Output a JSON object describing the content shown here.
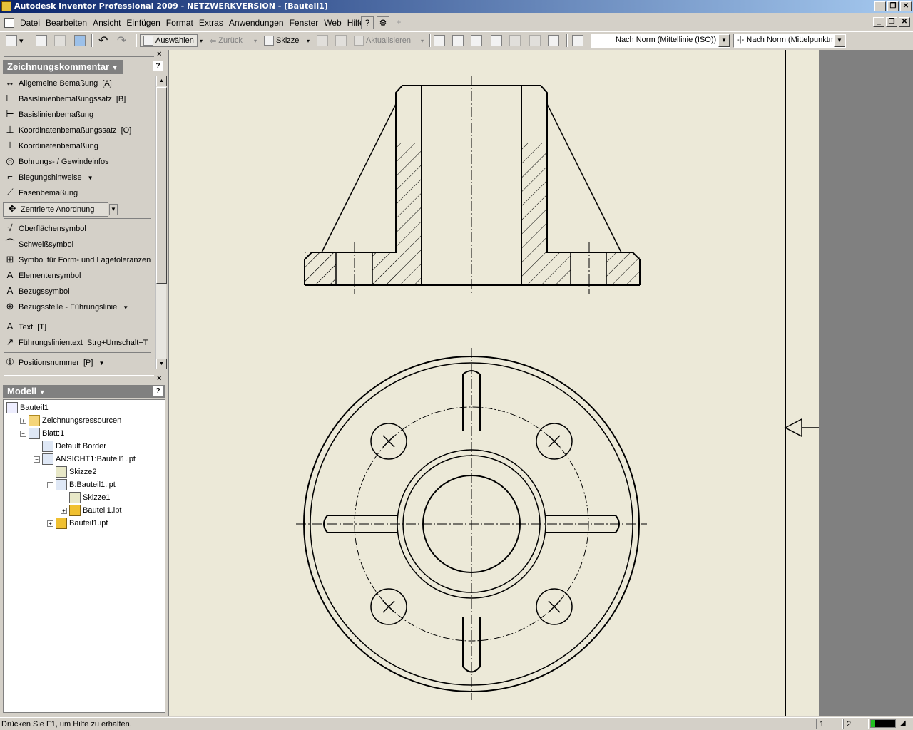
{
  "window": {
    "title": "Autodesk Inventor Professional 2009 - NETZWERKVERSION - [Bauteil1]",
    "min_label": "_",
    "max_label": "❐",
    "close_label": "✕"
  },
  "menu": {
    "items": [
      "Datei",
      "Bearbeiten",
      "Ansicht",
      "Einfügen",
      "Format",
      "Extras",
      "Anwendungen",
      "Fenster",
      "Web",
      "Hilfe"
    ]
  },
  "toolbar": {
    "select_label": "Auswählen",
    "back_label": "Zurück",
    "sketch_label": "Skizze",
    "update_label": "Aktualisieren",
    "layer_combo": "Nach Norm (Mittellinie (ISO))",
    "style_combo": "Nach Norm (Mittelpunktm"
  },
  "annotation_panel": {
    "title": "Zeichnungskommentar",
    "tools": [
      {
        "label": "Allgemeine Bemaßung",
        "shortcut": "[A]",
        "icon": "general-dimension-icon"
      },
      {
        "label": "Basislinienbemaßungssatz",
        "shortcut": "[B]",
        "icon": "baseline-set-icon"
      },
      {
        "label": "Basislinienbemaßung",
        "shortcut": "",
        "icon": "baseline-icon"
      },
      {
        "label": "Koordinatenbemaßungssatz",
        "shortcut": "[O]",
        "icon": "ordinate-set-icon"
      },
      {
        "label": "Koordinatenbemaßung",
        "shortcut": "",
        "icon": "ordinate-icon"
      },
      {
        "label": "Bohrungs- / Gewindeinfos",
        "shortcut": "",
        "icon": "hole-thread-icon"
      },
      {
        "label": "Biegungshinweise",
        "shortcut": "",
        "icon": "bend-note-icon",
        "dropdown": true
      },
      {
        "label": "Fasenbemaßung",
        "shortcut": "",
        "icon": "chamfer-icon"
      }
    ],
    "centered_pattern": "Zentrierte Anordnung",
    "tools2": [
      {
        "label": "Oberflächensymbol",
        "shortcut": "",
        "icon": "surface-symbol-icon"
      },
      {
        "label": "Schweißsymbol",
        "shortcut": "",
        "icon": "weld-symbol-icon"
      },
      {
        "label": "Symbol für Form- und Lagetoleranzen",
        "shortcut": "",
        "icon": "tolerance-symbol-icon"
      },
      {
        "label": "Elementensymbol",
        "shortcut": "",
        "icon": "feature-symbol-icon"
      },
      {
        "label": "Bezugssymbol",
        "shortcut": "",
        "icon": "datum-symbol-icon"
      },
      {
        "label": "Bezugsstelle - Führungslinie",
        "shortcut": "",
        "icon": "datum-target-icon",
        "dropdown": true
      }
    ],
    "tools3": [
      {
        "label": "Text",
        "shortcut": "[T]",
        "icon": "text-icon"
      },
      {
        "label": "Führungslinientext",
        "shortcut": "Strg+Umschalt+T",
        "icon": "leader-text-icon"
      }
    ],
    "tools4": [
      {
        "label": "Positionsnummer",
        "shortcut": "[P]",
        "icon": "balloon-icon",
        "dropdown": true
      }
    ]
  },
  "model_panel": {
    "title": "Modell",
    "nodes": [
      {
        "label": "Bauteil1",
        "level": 0,
        "expander": "",
        "icon": "drawing-icon"
      },
      {
        "label": "Zeichnungsressourcen",
        "level": 1,
        "expander": "+",
        "icon": "folder-icon"
      },
      {
        "label": "Blatt:1",
        "level": 1,
        "expander": "−",
        "icon": "sheet-icon"
      },
      {
        "label": "Default Border",
        "level": 2,
        "expander": "",
        "icon": "border-icon"
      },
      {
        "label": "ANSICHT1:Bauteil1.ipt",
        "level": 2,
        "expander": "−",
        "icon": "view-icon"
      },
      {
        "label": "Skizze2",
        "level": 3,
        "expander": "",
        "icon": "sketch-icon"
      },
      {
        "label": "B:Bauteil1.ipt",
        "level": 3,
        "expander": "−",
        "icon": "section-view-icon"
      },
      {
        "label": "Skizze1",
        "level": 4,
        "expander": "",
        "icon": "sketch-icon"
      },
      {
        "label": "Bauteil1.ipt",
        "level": 4,
        "expander": "+",
        "icon": "part-icon"
      },
      {
        "label": "Bauteil1.ipt",
        "level": 3,
        "expander": "+",
        "icon": "part-icon"
      }
    ]
  },
  "status": {
    "message": "Drücken Sie F1, um Hilfe zu erhalten.",
    "box1": "1",
    "box2": "2"
  }
}
